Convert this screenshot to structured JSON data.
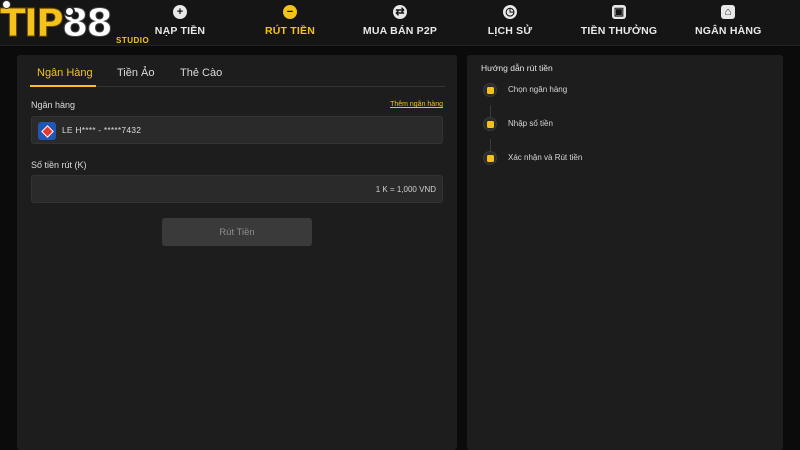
{
  "logo": {
    "main": "TIP",
    "number": "88",
    "sub": "STUDIO"
  },
  "nav": {
    "items": [
      {
        "label": "NẠP TIỀN",
        "icon": "plus-circle-icon",
        "glyph": "+"
      },
      {
        "label": "RÚT TIỀN",
        "icon": "minus-circle-icon",
        "glyph": "−",
        "active": true
      },
      {
        "label": "MUA BÁN P2P",
        "icon": "exchange-icon",
        "glyph": "⇄"
      },
      {
        "label": "LỊCH SỬ",
        "icon": "clock-icon",
        "glyph": "◷"
      },
      {
        "label": "TIỀN THƯỞNG",
        "icon": "gift-icon",
        "glyph": "▣"
      },
      {
        "label": "NGÂN HÀNG",
        "icon": "bank-icon",
        "glyph": "⌂"
      }
    ]
  },
  "tabs": [
    {
      "label": "Ngân Hàng",
      "active": true
    },
    {
      "label": "Tiền Ảo"
    },
    {
      "label": "Thẻ Cào"
    }
  ],
  "form": {
    "bank_label": "Ngân hàng",
    "add_bank_link": "Thêm ngân hàng",
    "bank_value": "LE H**** - *****7432",
    "amount_label": "Số tiền rút (K)",
    "amount_value": "",
    "amount_hint": "1 K = 1,000 VND",
    "submit_label": "Rút Tiền"
  },
  "guide": {
    "title": "Hướng dẫn rút tiền",
    "steps": [
      {
        "label": "Chọn ngân hàng",
        "icon": "bank-check-icon"
      },
      {
        "label": "Nhập số tiền",
        "icon": "note-icon"
      },
      {
        "label": "Xác nhận và Rút tiền",
        "icon": "wallet-icon"
      }
    ]
  },
  "colors": {
    "accent": "#f4c21a",
    "background": "#0b0b0b",
    "panel": "#1d1d1d",
    "input": "#2a2a2a",
    "button_disabled": "#3a3a3a"
  }
}
